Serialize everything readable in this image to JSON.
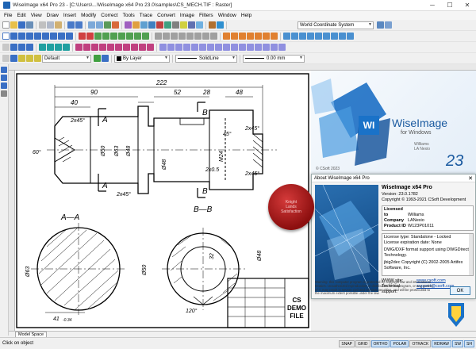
{
  "window": {
    "title": "WiseImage x64 Pro 23 - [C:\\Users\\...\\WiseImage x64 Pro 23.0\\samples\\CS_MECH.TIF : Raster]",
    "minimize": "─",
    "maximize": "☐",
    "close": "✕"
  },
  "menu": [
    "File",
    "Edit",
    "View",
    "Draw",
    "Insert",
    "Modify",
    "Correct",
    "Tools",
    "Trace",
    "Convert",
    "Image",
    "Filters",
    "Window",
    "Help"
  ],
  "toolbar": {
    "coordinate_system": "World Coordinate System",
    "layer": "Default",
    "color": "By Layer",
    "linetype": "SolidLine",
    "lineweight": "0.00 mm"
  },
  "drawing": {
    "dims": {
      "d222": "222",
      "d90": "90",
      "d52": "52",
      "d28": "28",
      "d48": "48",
      "d40": "40",
      "c2x45a": "2x45°",
      "c2x45b": "2x45°",
      "c2x45c": "2x45°",
      "c2x45d": "2x45°",
      "c2x05": "2x0.5",
      "a60": "60°",
      "a45": "45°",
      "a120": "120°",
      "d50": "Ø50",
      "d63": "Ø63",
      "d48b": "Ø48",
      "d48c": "Ø48",
      "m24": "M24",
      "d63b": "Ø63",
      "d50b": "Ø50",
      "d41": "41",
      "d41tol": "-0.34",
      "d48d": "Ø48",
      "d32": "32"
    },
    "section_a": "A—A",
    "section_b": "B—B",
    "letter_a1": "A",
    "letter_a2": "A",
    "letter_b1": "B",
    "letter_b2": "B",
    "stamp": [
      "CS",
      "DEMO",
      "FILE"
    ]
  },
  "splash": {
    "brand": "WiseImage",
    "sub": "for Windows",
    "version_big": "23",
    "copyright": "© CSoft 2023",
    "credit1": "Williams",
    "credit2": "LA Nexio"
  },
  "about": {
    "title": "About WiseImage x64 Pro",
    "product": "WiseImage x64 Pro",
    "version": "Version: 23.0.1782",
    "copyright": "Copyright © 1993-2021 CSoft Development",
    "licensed_to_label": "Licensed to",
    "licensed_to": "Williams",
    "company_label": "Company",
    "company": "LANexio",
    "product_id_label": "Product ID",
    "product_id": "W123P01011",
    "license_type": "License type: Standalone - Locked",
    "license_exp": "License expiration date: None",
    "dwg": "DWG/DXF format support using DWGDirect Technology.",
    "jbig": "jbig2dec Copyright (C) 2002-2005 Artifex Software, Inc.",
    "www_label": "WWW site:",
    "www": "www.csoft.com",
    "support_label": "Technical support:",
    "support": "support@csoft.com",
    "warning": "Warning: this computer program is protected by copyright law and international treaties. Unauthorized reproduction or distribution of this program, or any portion of it, may result in severe civil and criminal penalties, and will be prosecuted to the maximum extent possible under the law.",
    "ok": "OK"
  },
  "seal": {
    "line1": "Knight",
    "line2": "Lands",
    "line3": "Satisfaction"
  },
  "tabs": {
    "model": "Model Space"
  },
  "status": {
    "text": "Click on object",
    "buttons": [
      "SNAP",
      "GRID",
      "ORTHO",
      "POLAR",
      "OTRACK",
      "RDRAW",
      "SW",
      "SH"
    ],
    "on": [
      "ORTHO",
      "POLAR",
      "RDRAW",
      "SW",
      "SH"
    ]
  }
}
